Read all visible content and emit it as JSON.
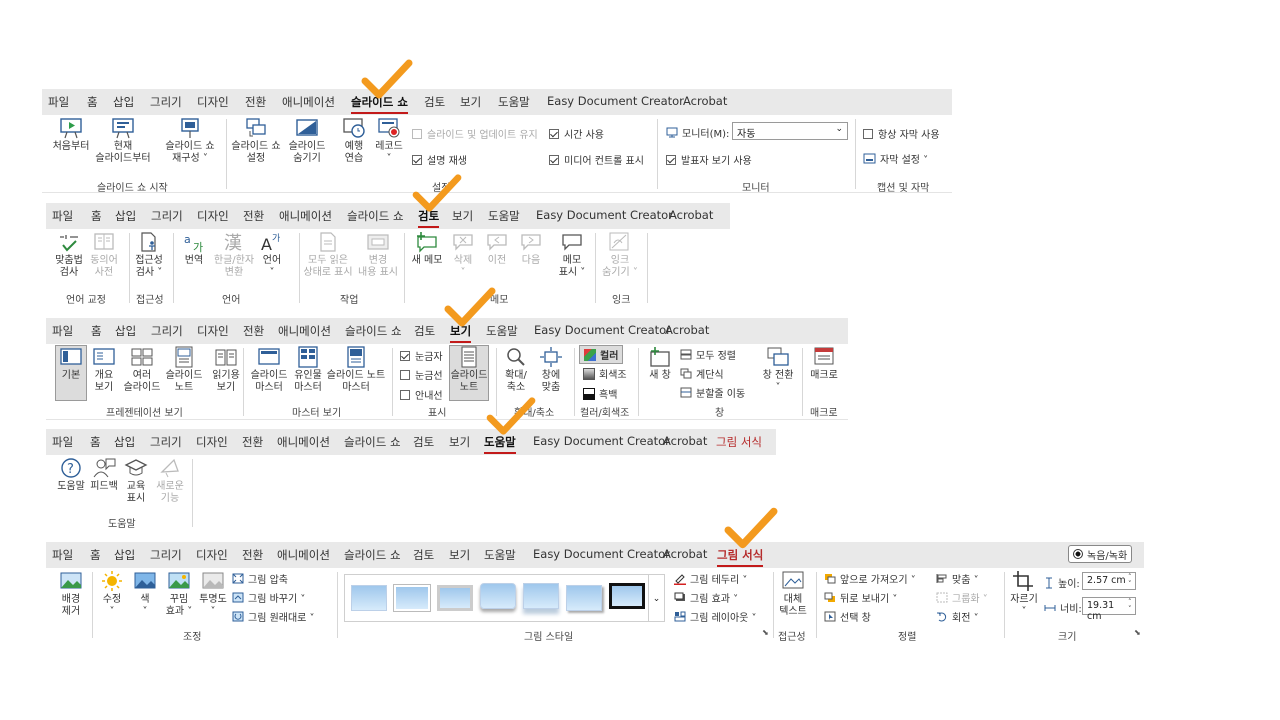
{
  "tabs": {
    "r1": [
      "파일",
      "홈",
      "삽입",
      "그리기",
      "디자인",
      "전환",
      "애니메이션",
      "슬라이드 쇼",
      "검토",
      "보기",
      "도움말",
      "Easy Document Creator",
      "Acrobat"
    ],
    "r2": [
      "파일",
      "홈",
      "삽입",
      "그리기",
      "디자인",
      "전환",
      "애니메이션",
      "슬라이드 쇼",
      "검토",
      "보기",
      "도움말",
      "Easy Document Creator",
      "Acrobat"
    ],
    "r3": [
      "파일",
      "홈",
      "삽입",
      "그리기",
      "디자인",
      "전환",
      "애니메이션",
      "슬라이드 쇼",
      "검토",
      "보기",
      "도움말",
      "Easy Document Creator",
      "Acrobat"
    ],
    "r4": [
      "파일",
      "홈",
      "삽입",
      "그리기",
      "디자인",
      "전환",
      "애니메이션",
      "슬라이드 쇼",
      "검토",
      "보기",
      "도움말",
      "Easy Document Creator",
      "Acrobat",
      "그림 서식"
    ],
    "r5": [
      "파일",
      "홈",
      "삽입",
      "그리기",
      "디자인",
      "전환",
      "애니메이션",
      "슬라이드 쇼",
      "검토",
      "보기",
      "도움말",
      "Easy Document Creator",
      "Acrobat",
      "그림 서식"
    ]
  },
  "record_button": "녹음/녹화",
  "slideshow": {
    "from_start": "처음부터",
    "from_current": "현재\n슬라이드부터",
    "reconfig": "슬라이드 쇼\n재구성 ˅",
    "group_start": "슬라이드 쇼 시작",
    "setup": "슬라이드 쇼\n설정",
    "hide": "슬라이드\n숨기기",
    "rehearse": "예행\n연습",
    "record": "레코드\n˅",
    "keep_updated": "슬라이드 및 업데이트 유지",
    "use_timings": "시간 사용",
    "narrations": "설명 재생",
    "media_controls": "미디어 컨트롤 표시",
    "group_setup": "설정",
    "monitor_label": "모니터(M):",
    "monitor_value": "자동",
    "presenter_view": "발표자 보기 사용",
    "group_monitor": "모니터",
    "always_subtitles": "항상 자막 사용",
    "subtitle_settings": "자막 설정 ˅",
    "group_captions": "캡션 및 자막"
  },
  "review": {
    "spelling": "맞춤법\n검사",
    "thesaurus": "동의어\n사전",
    "group_proofing": "언어 교정",
    "accessibility": "접근성\n검사 ˅",
    "group_access": "접근성",
    "translate": "번역",
    "hanja": "한글/한자\n변환",
    "language": "언어\n˅",
    "group_language": "언어",
    "show_all_read": "모두 읽은\n상태로 표시",
    "show_changes": "변경\n내용 표시",
    "group_activity": "작업",
    "new_comment": "새 메모",
    "delete": "삭제\n˅",
    "previous": "이전",
    "next": "다음",
    "show_comments": "메모\n표시 ˅",
    "group_comments": "메모",
    "hide_ink": "잉크\n숨기기 ˅",
    "group_ink": "잉크"
  },
  "view": {
    "normal": "기본",
    "outline": "개요\n보기",
    "sorter": "여러\n슬라이드",
    "notes_page": "슬라이드\n노트",
    "reading": "읽기용\n보기",
    "group_pres_views": "프레젠테이션 보기",
    "slide_master": "슬라이드\n마스터",
    "handout_master": "유인물\n마스터",
    "notes_master": "슬라이드 노트\n마스터",
    "group_master": "마스터 보기",
    "ruler": "눈금자",
    "gridlines": "눈금선",
    "guides": "안내선",
    "notes": "슬라이드\n노트",
    "group_show": "표시",
    "zoom": "확대/\n축소",
    "fit": "창에\n맞춤",
    "group_zoom": "확대/축소",
    "color": "컬러",
    "grayscale": "회색조",
    "bw": "흑백",
    "group_color": "컬러/회색조",
    "new_window": "새 창",
    "arrange_all": "모두 정렬",
    "cascade": "계단식",
    "move_split": "분할줄 이동",
    "switch_windows": "창 전환\n˅",
    "group_window": "창",
    "macros": "매크로",
    "group_macros": "매크로"
  },
  "help": {
    "help": "도움말",
    "feedback": "피드백",
    "training": "교육\n표시",
    "whats_new": "새로운\n기능",
    "group_help": "도움말"
  },
  "picture": {
    "remove_bg": "배경\n제거",
    "corrections": "수정\n˅",
    "color": "색\n˅",
    "artistic": "꾸밈\n효과 ˅",
    "transparency": "투명도\n˅",
    "compress": "그림 압축",
    "change": "그림 바꾸기 ˅",
    "reset": "그림 원래대로  ˅",
    "group_adjust": "조정",
    "border": "그림 테두리 ˅",
    "effects": "그림 효과 ˅",
    "layout": "그림 레이아웃 ˅",
    "group_styles": "그림 스타일",
    "alt_text": "대체\n텍스트",
    "group_access": "접근성",
    "bring_forward": "앞으로 가져오기  ˅",
    "send_backward": "뒤로 보내기   ˅",
    "selection_pane": "선택 창",
    "align": "맞춤 ˅",
    "group_obj": "그룹화 ˅",
    "rotate": "회전 ˅",
    "group_arrange": "정렬",
    "crop": "자르기\n˅",
    "height_label": "높이:",
    "height_value": "2.57 cm",
    "width_label": "너비:",
    "width_value": "19.31 cm",
    "group_size": "크기"
  },
  "colors": {
    "accent_red": "#c21a1a",
    "check_orange": "#f39a1e",
    "tab_bg": "#e9e9e9"
  }
}
